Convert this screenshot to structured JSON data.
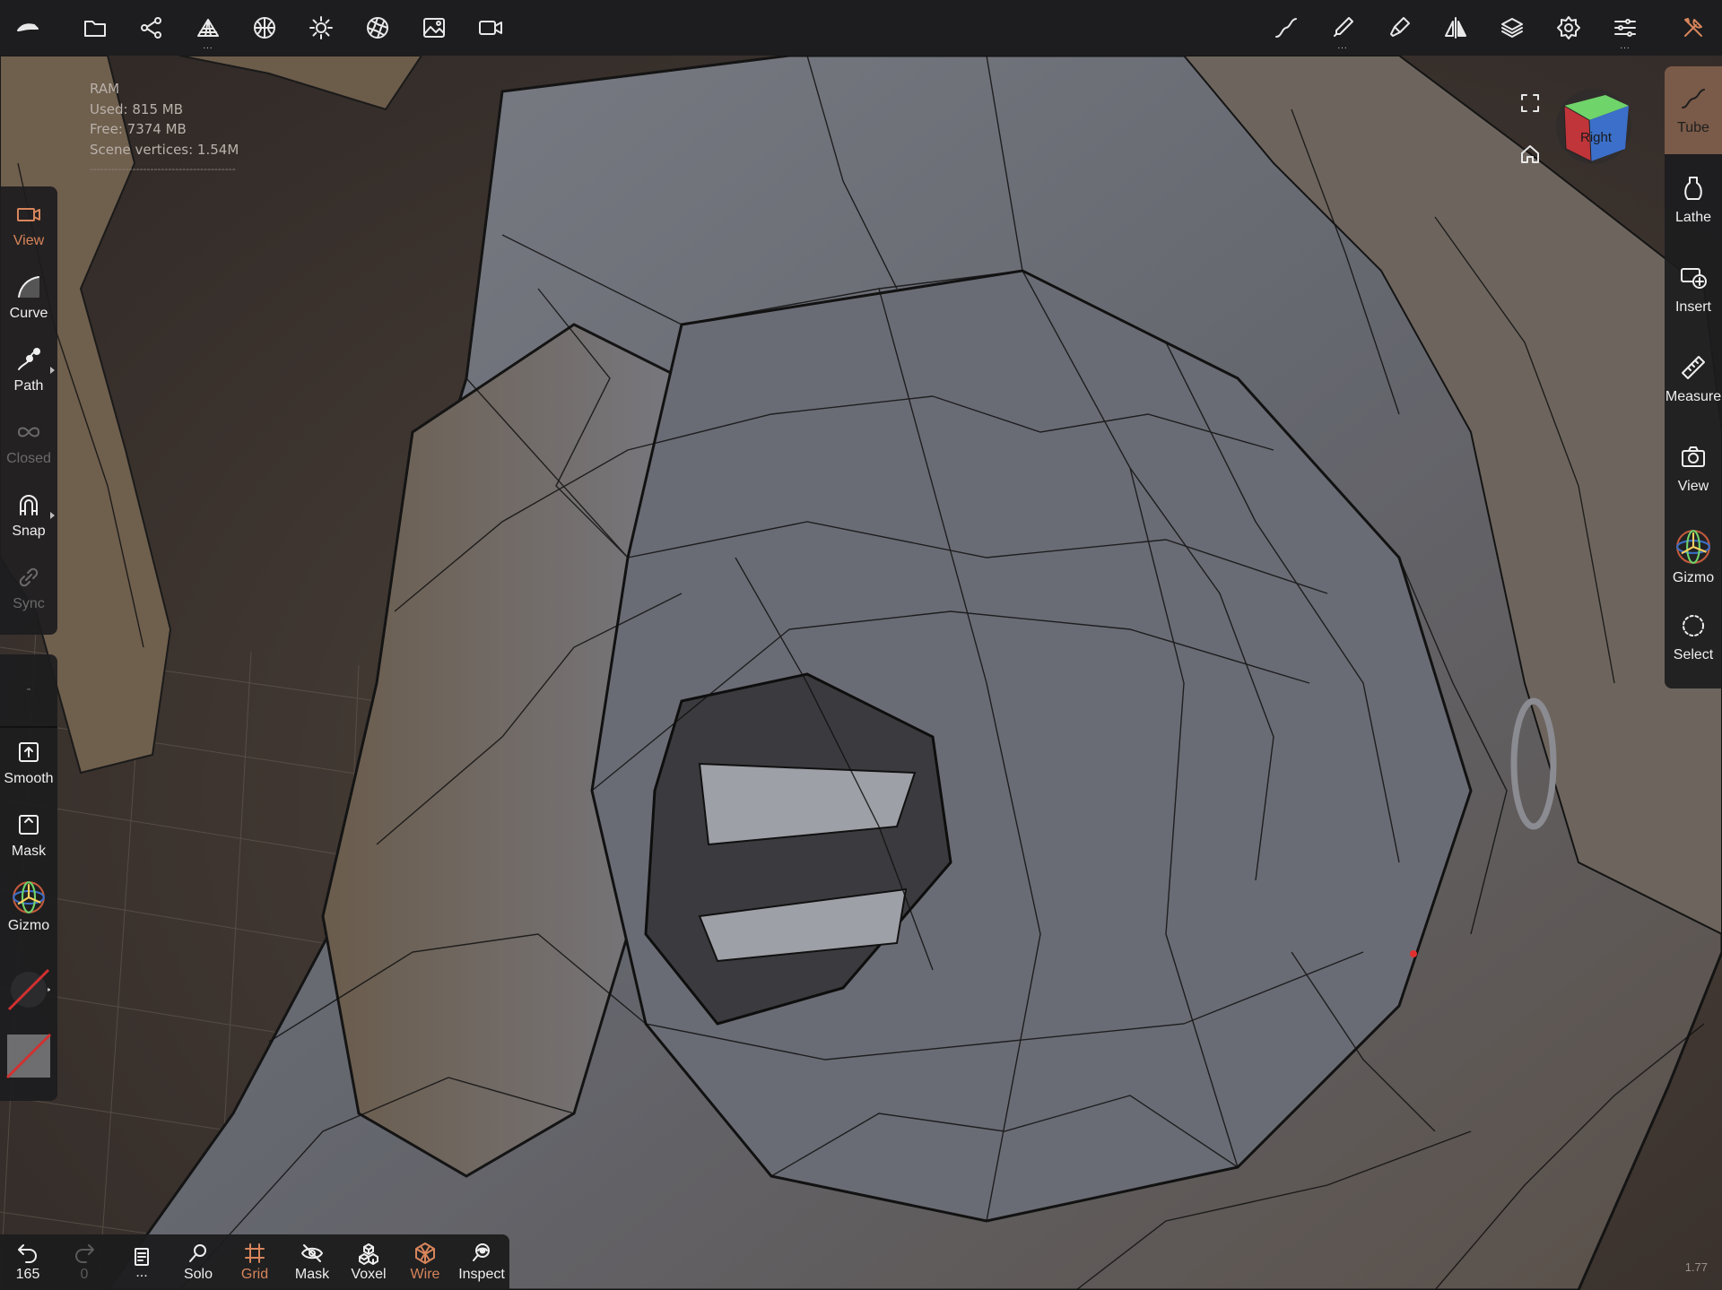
{
  "stats": {
    "ram_label": "RAM",
    "used": "Used: 815 MB",
    "free": "Free: 7374 MB",
    "vertices": "Scene vertices: 1.54M",
    "separator": "-----------------------------------------"
  },
  "topbar": {
    "left_icons": [
      "app-logo-icon",
      "folder-icon",
      "scene-graph-icon",
      "topology-icon",
      "material-sphere-icon",
      "light-icon",
      "post-process-icon",
      "background-image-icon",
      "video-icon"
    ],
    "right_icons": [
      "stroke-icon",
      "brush-icon",
      "paint-icon",
      "symmetry-icon",
      "layers-icon",
      "settings-icon",
      "sliders-icon",
      "tools-icon"
    ],
    "more_indicator": "..."
  },
  "left_panel": {
    "view": "View",
    "curve": "Curve",
    "path": "Path",
    "closed": "Closed",
    "snap": "Snap",
    "sync": "Sync",
    "blank": "-",
    "smooth": "Smooth",
    "mask": "Mask",
    "gizmo": "Gizmo"
  },
  "right_panel": {
    "tube": "Tube",
    "lathe": "Lathe",
    "insert": "Insert",
    "measure": "Measure",
    "view": "View",
    "gizmo": "Gizmo",
    "select": "Select"
  },
  "nav_cube": {
    "face_label": "Right",
    "colors": {
      "right": "#c0353a",
      "top": "#6fd46a",
      "front": "#3b6fc9"
    }
  },
  "bottombar": {
    "undo_count": "165",
    "redo_count": "0",
    "more": "...",
    "solo": "Solo",
    "grid": "Grid",
    "mask": "Mask",
    "voxel": "Voxel",
    "wire": "Wire",
    "inspect": "Inspect"
  },
  "version": "1.77",
  "colors": {
    "accent": "#d8855b",
    "panel_bg": "#1c1c1e",
    "mesh_fill": "#6c6f78",
    "wire": "#151515"
  }
}
